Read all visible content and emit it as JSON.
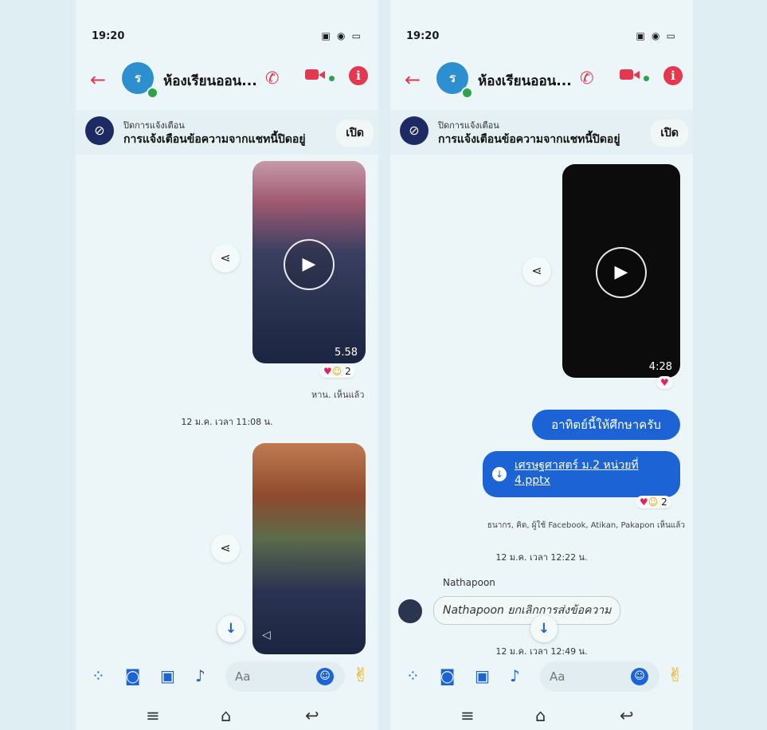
{
  "left_screen": {
    "status_time": "19:20",
    "status_icons": "▣ ◉ ▭",
    "title": "ห้องเรียนออน...",
    "avatar_initial": "ร",
    "banner_label": "ปิดการแจ้งเตือน",
    "banner_text": "การแจ้งเตือนข้อความจากแชทนี้ปิดอยู่",
    "banner_button": "เปิด",
    "video1_duration": "5.58",
    "video1_reaction_count": "2",
    "video1_seen": "หาน. เห็นแล้ว",
    "timestamp": "12 ม.ค. เวลา 11:08 น.",
    "composer_placeholder": "Aa"
  },
  "right_screen": {
    "status_time": "19:20",
    "status_icons": "▣ ◉ ▭",
    "title": "ห้องเรียนออน...",
    "avatar_initial": "ร",
    "banner_label": "ปิดการแจ้งเตือน",
    "banner_text": "การแจ้งเตือนข้อความจากแชทนี้ปิดอยู่",
    "banner_button": "เปิด",
    "video_duration": "4:28",
    "text_message": "อาทิตย์นี้ให้ศึกษาครับ",
    "file_name": "เศรษฐศาสตร์ ม.2 หน่วยที่ 4.pptx",
    "file_reaction_count": "2",
    "file_seen": "ธนากร, คิด, ผู้ใช้ Facebook, Atikan, Pakapon เห็นแล้ว",
    "timestamp1": "12 ม.ค. เวลา 12:22 น.",
    "sender_name": "Nathapoon",
    "unsent_text": "Nathapoon ยกเลิกการส่งข้อความ",
    "timestamp2": "12 ม.ค. เวลา 12:49 น.",
    "composer_placeholder": "Aa"
  },
  "icons": [
    "back-arrow-icon",
    "phone-icon",
    "video-icon",
    "info-icon",
    "mute-icon",
    "share-icon",
    "play-icon",
    "heart-icon",
    "emoji-icon",
    "download-icon",
    "scroll-down-icon",
    "apps-icon",
    "camera-icon",
    "gallery-icon",
    "microphone-icon",
    "hand-icon",
    "menu-icon",
    "home-icon",
    "return-icon"
  ],
  "colors": {
    "accent_red": "#e3384f",
    "messenger_blue": "#1c63d6",
    "online_green": "#31a24c",
    "mute_navy": "#1d2a63"
  }
}
